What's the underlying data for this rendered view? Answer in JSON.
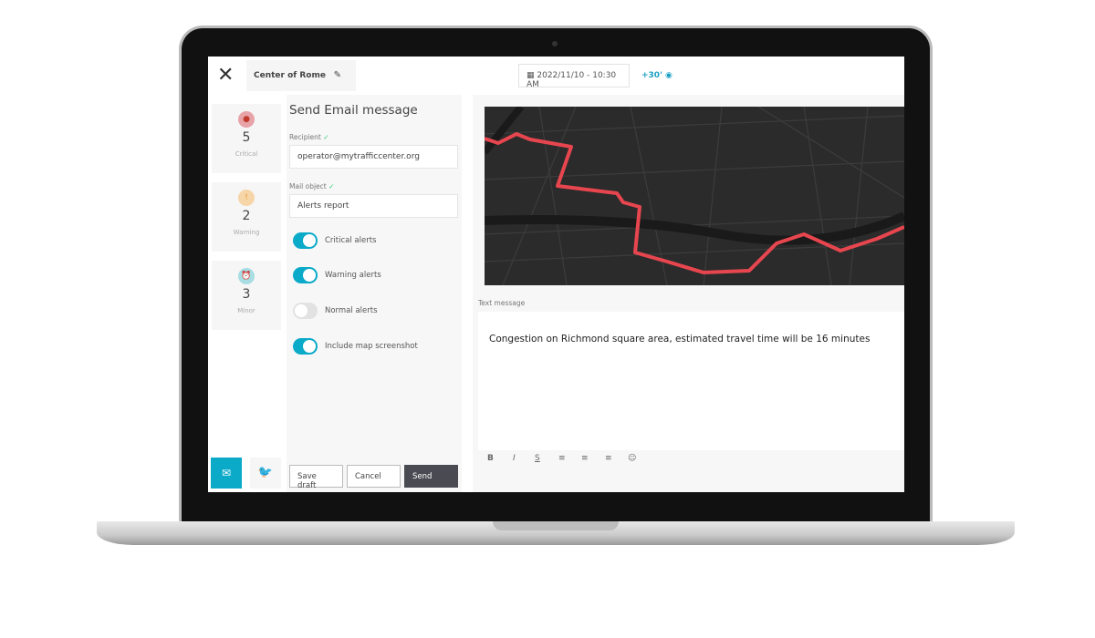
{
  "header": {
    "location": "Center of Rome",
    "datetime": "2022/11/10 - 10:30 AM",
    "offset": "+30'"
  },
  "alerts": [
    {
      "count": "5",
      "label": "Critical",
      "icon": "bomb-icon",
      "color": "#e7a3a8"
    },
    {
      "count": "2",
      "label": "Warning",
      "icon": "exclamation-icon",
      "color": "#f6d6a8"
    },
    {
      "count": "3",
      "label": "Minor",
      "icon": "alarm-clock-icon",
      "color": "#a8dde3"
    }
  ],
  "form": {
    "title": "Send Email message",
    "recipient_label": "Recipient",
    "recipient_value": "operator@mytrafficcenter.org",
    "object_label": "Mail object",
    "object_value": "Alerts report",
    "toggles": [
      {
        "label": "Critical alerts",
        "on": true
      },
      {
        "label": "Warning alerts",
        "on": true
      },
      {
        "label": "Normal alerts",
        "on": false
      },
      {
        "label": "Include map screenshot",
        "on": true
      }
    ],
    "save_label": "Save draft",
    "cancel_label": "Cancel",
    "send_label": "Send"
  },
  "message": {
    "label": "Text message",
    "text": "Congestion on Richmond square area, estimated travel time will be 16 minutes",
    "toolbar": [
      "B",
      "I",
      "S",
      "≡",
      "≡",
      "≡",
      "☺"
    ]
  },
  "colors": {
    "accent": "#0aaac8",
    "route": "#e8464f"
  }
}
